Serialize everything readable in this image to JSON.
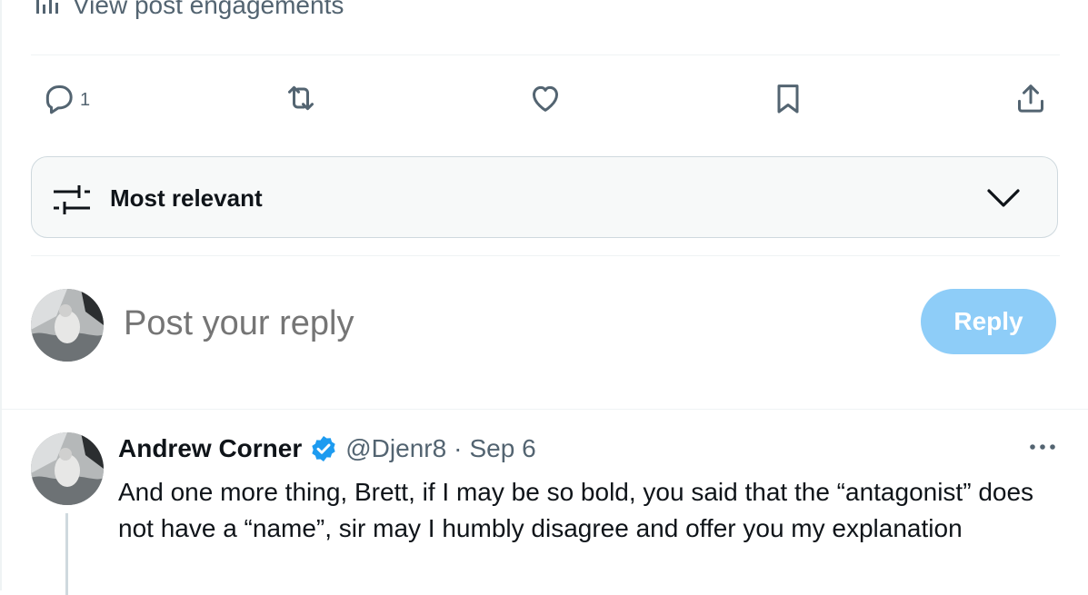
{
  "engagements": {
    "label": "View post engagements",
    "icon": "analytics-icon"
  },
  "actions": {
    "reply_count": "1",
    "icons": [
      "reply-icon",
      "retweet-icon",
      "like-icon",
      "bookmark-icon",
      "share-icon"
    ]
  },
  "sort": {
    "label": "Most relevant",
    "icon": "sliders-icon",
    "chevron": "chevron-down-icon"
  },
  "composer": {
    "placeholder": "Post your reply",
    "button_label": "Reply",
    "button_color": "#8ecdf8"
  },
  "tweet": {
    "author": "Andrew Corner",
    "verified": true,
    "handle": "@Djenr8",
    "separator": "·",
    "date": "Sep 6",
    "body": "And one more thing, Brett, if I may be so bold, you said that the “antagonist” does not have a “name”, sir may I humbly disagree and offer you my explanation"
  },
  "colors": {
    "accent": "#1d9bf0",
    "muted": "#536471",
    "border": "#eff3f4"
  }
}
